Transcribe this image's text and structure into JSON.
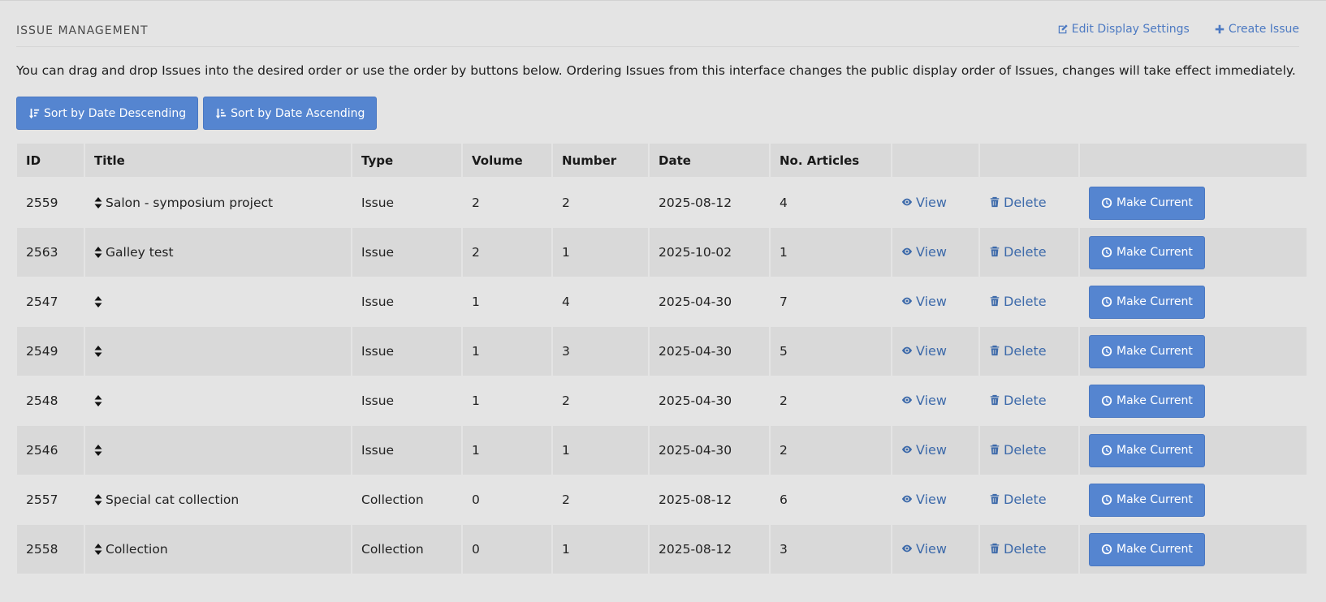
{
  "header": {
    "title": "ISSUE MANAGEMENT",
    "edit_display_settings": "Edit Display Settings",
    "create_issue": "Create Issue"
  },
  "description": "You can drag and drop Issues into the desired order or use the order by buttons below. Ordering Issues from this interface changes the public display order of Issues, changes will take effect immediately.",
  "sort": {
    "desc_label": "Sort by Date Descending",
    "asc_label": "Sort by Date Ascending"
  },
  "table": {
    "columns": [
      "ID",
      "Title",
      "Type",
      "Volume",
      "Number",
      "Date",
      "No. Articles"
    ],
    "view_label": "View",
    "delete_label": "Delete",
    "make_current_label": "Make Current",
    "rows": [
      {
        "id": "2559",
        "title": "Salon - symposium project",
        "type": "Issue",
        "volume": "2",
        "number": "2",
        "date": "2025-08-12",
        "articles": "4"
      },
      {
        "id": "2563",
        "title": "Galley test",
        "type": "Issue",
        "volume": "2",
        "number": "1",
        "date": "2025-10-02",
        "articles": "1"
      },
      {
        "id": "2547",
        "title": "",
        "type": "Issue",
        "volume": "1",
        "number": "4",
        "date": "2025-04-30",
        "articles": "7"
      },
      {
        "id": "2549",
        "title": "",
        "type": "Issue",
        "volume": "1",
        "number": "3",
        "date": "2025-04-30",
        "articles": "5"
      },
      {
        "id": "2548",
        "title": "",
        "type": "Issue",
        "volume": "1",
        "number": "2",
        "date": "2025-04-30",
        "articles": "2"
      },
      {
        "id": "2546",
        "title": "",
        "type": "Issue",
        "volume": "1",
        "number": "1",
        "date": "2025-04-30",
        "articles": "2"
      },
      {
        "id": "2557",
        "title": "Special cat collection",
        "type": "Collection",
        "volume": "0",
        "number": "2",
        "date": "2025-08-12",
        "articles": "6"
      },
      {
        "id": "2558",
        "title": "Collection",
        "type": "Collection",
        "volume": "0",
        "number": "1",
        "date": "2025-08-12",
        "articles": "3"
      }
    ]
  },
  "colors": {
    "background": "#e4e4e4",
    "row_alt": "#d9d9d9",
    "button": "#5585d0",
    "link": "#3d6aaa"
  }
}
